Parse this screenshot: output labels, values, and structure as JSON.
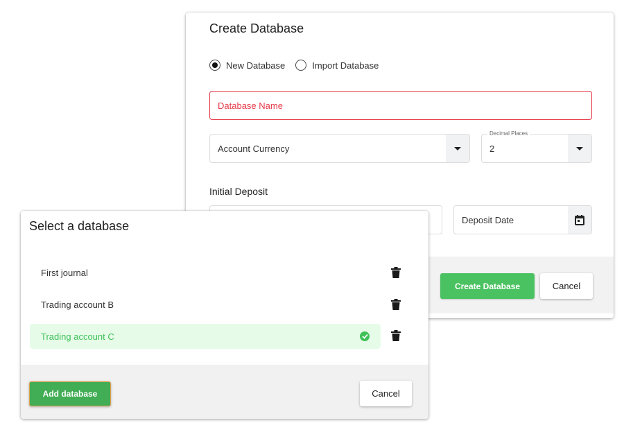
{
  "create_dialog": {
    "title": "Create Database",
    "radio_options": [
      {
        "label": "New Database",
        "checked": true
      },
      {
        "label": "Import Database",
        "checked": false
      }
    ],
    "database_name": {
      "placeholder": "Database Name",
      "value": "",
      "state": "error"
    },
    "account_currency": {
      "placeholder": "Account Currency",
      "value": ""
    },
    "decimal_places": {
      "label": "Decimal Places",
      "value": "2"
    },
    "initial_deposit_label": "Initial Deposit",
    "deposit_amount": {
      "value": ""
    },
    "deposit_date": {
      "placeholder": "Deposit Date",
      "value": ""
    },
    "buttons": {
      "create": "Create Database",
      "cancel": "Cancel"
    },
    "colors": {
      "primary": "#4bc261",
      "error": "#e53946"
    }
  },
  "select_dialog": {
    "title": "Select a database",
    "items": [
      {
        "label": "First journal",
        "selected": false
      },
      {
        "label": "Trading account B",
        "selected": false
      },
      {
        "label": "Trading account C",
        "selected": true
      }
    ],
    "buttons": {
      "add": "Add database",
      "cancel": "Cancel"
    },
    "colors": {
      "selected_bg": "#e6fbe8",
      "selected_text": "#3ec158",
      "add_button": "#41ad55",
      "focus_ring": "#e0a14a"
    }
  },
  "icons": {
    "dropdown": "caret-down-icon",
    "calendar": "calendar-icon",
    "delete": "trash-icon",
    "selected": "check-circle-icon"
  }
}
